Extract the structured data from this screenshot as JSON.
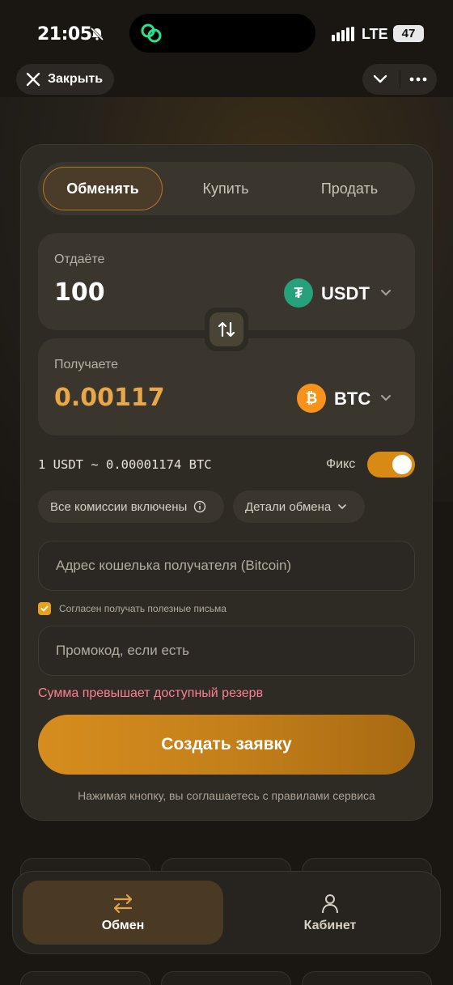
{
  "status_bar": {
    "time": "21:05",
    "network": "LTE",
    "battery": "47"
  },
  "top_bar": {
    "close_label": "Закрыть"
  },
  "tabs": [
    {
      "label": "Обменять",
      "active": true
    },
    {
      "label": "Купить",
      "active": false
    },
    {
      "label": "Продать",
      "active": false
    }
  ],
  "give": {
    "label": "Отдаёте",
    "amount": "100",
    "currency": "USDT",
    "currency_color": "#26a17b",
    "icon": "tether-icon"
  },
  "get": {
    "label": "Получаете",
    "amount": "0.00117",
    "currency": "BTC",
    "currency_color": "#f7931a",
    "icon": "bitcoin-icon"
  },
  "rate_text": "1 USDT ~ 0.00001174 BTC",
  "fix": {
    "label": "Фикс",
    "enabled": true
  },
  "chips": {
    "fees": "Все комиссии включены",
    "details": "Детали обмена"
  },
  "address": {
    "placeholder": "Адрес кошелька получателя (Bitcoin)"
  },
  "newsletter": {
    "label": "Согласен получать полезные письма",
    "checked": true
  },
  "promo": {
    "placeholder": "Промокод, если есть"
  },
  "error_text": "Сумма превышает доступный резерв",
  "submit_label": "Создать заявку",
  "terms_text": "Нажимая кнопку, вы соглашаетесь с правилами сервиса",
  "nav": [
    {
      "label": "Обмен",
      "icon": "exchange-arrows-icon",
      "active": true
    },
    {
      "label": "Кабинет",
      "icon": "user-icon",
      "active": false
    }
  ],
  "colors": {
    "accent": "#d88a14",
    "error": "#ff7f93",
    "background": "#1a1713"
  }
}
